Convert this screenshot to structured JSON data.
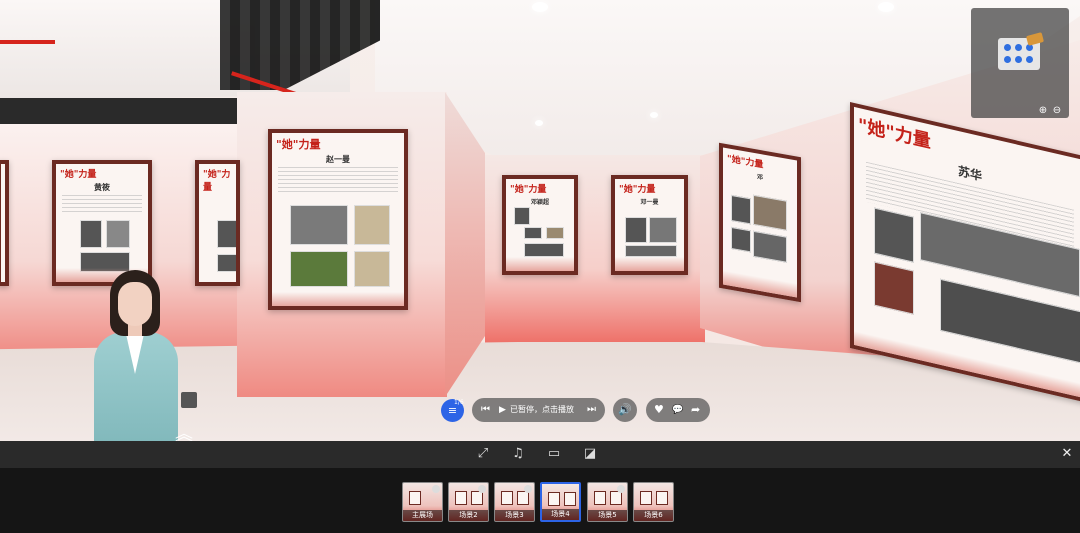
{
  "scene": {
    "poster_heading": "\"她\"力量",
    "posters": [
      {
        "id": "left-edge"
      },
      {
        "id": "left-1",
        "title": "黄筱"
      },
      {
        "id": "left-2"
      },
      {
        "id": "pillar",
        "title": "赵一曼"
      },
      {
        "id": "back-1",
        "title": "邓颖超"
      },
      {
        "id": "back-2",
        "title": "邓一曼"
      },
      {
        "id": "right-1",
        "title": "邓"
      },
      {
        "id": "right-big",
        "title": "苏华"
      }
    ]
  },
  "minimap": {
    "zoom_in_icon": "zoom-in-icon",
    "zoom_out_icon": "zoom-out-icon"
  },
  "controls": {
    "menu_badge": "1/6",
    "player_label": "已暂停，点击播放",
    "prev_glyph": "⏮",
    "play_glyph": "▶",
    "next_glyph": "⏭",
    "volume_glyph": "🔊",
    "like_glyph": "♥",
    "comment_glyph": "💬",
    "share_glyph": "➦"
  },
  "toolbar": {
    "fullscreen_glyph": "⤢",
    "music_glyph": "♫",
    "vr_glyph": "▭",
    "gyro_glyph": "◪",
    "close_glyph": "✕"
  },
  "thumbnails": [
    {
      "label": "主展场",
      "active": false
    },
    {
      "label": "场景2",
      "active": false
    },
    {
      "label": "场景3",
      "active": false
    },
    {
      "label": "场景4",
      "active": true
    },
    {
      "label": "场景5",
      "active": false
    },
    {
      "label": "场景6",
      "active": false
    }
  ],
  "colors": {
    "accent": "#2d64e6",
    "brand_red": "#c4221a",
    "frame": "#6b2a22"
  }
}
